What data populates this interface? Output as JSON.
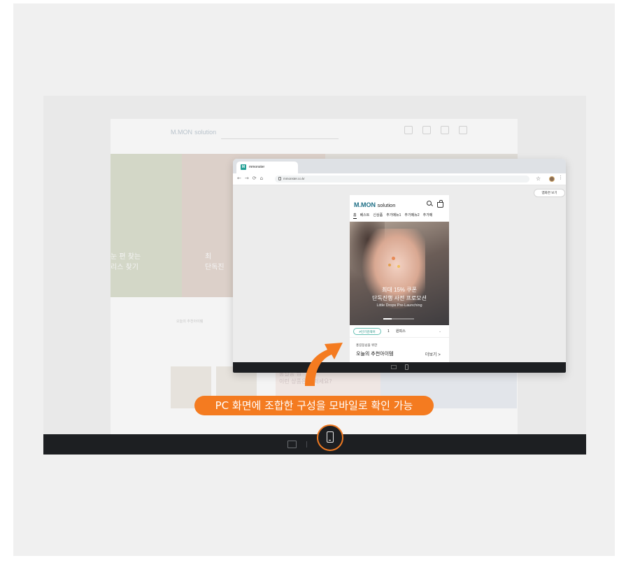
{
  "background_page": {
    "logo_main": "M.MON",
    "logo_sub": "solution",
    "search_placeholder": "",
    "menu": "",
    "hero_left_text": "눈 편 찾는\n리스 찾기",
    "hero_mid_text": "최\n단독진",
    "recommend_sub": "",
    "recommend_title": "오늘의 추천아이템",
    "greeting": "홍길동 님\n이런 상품은 어떠세요?"
  },
  "browser": {
    "tab_title": "mmonster",
    "favicon_letter": "M",
    "url": "mmonster.co.kr",
    "app_button": "앱화면 보기"
  },
  "mobile": {
    "brand_main": "M.MON",
    "brand_sub": "solution",
    "menu": [
      "홈",
      "베스트",
      "신상품",
      "추가메뉴1",
      "추가메뉴2",
      "추가메"
    ],
    "banner": {
      "line1": "최대 15% 쿠폰",
      "line2": "단독진행 사전 프로모션",
      "line3": "Little Drops Pre-Launching"
    },
    "keyword_pill": "#인기검색어",
    "keyword_rank": "1",
    "keyword_word": "원피스",
    "recommend_sub": "홍길동님을 위한",
    "recommend_title": "오늘의 추천아이템",
    "more": "더보기 >"
  },
  "callout": "PC 화면에 조합한 구성을 모바일로 확인 가능",
  "icons": {
    "pc_view": "desktop-icon",
    "mobile_view": "mobile-icon"
  },
  "colors": {
    "accent": "#f47b20",
    "brand_teal": "#1c6d84",
    "keyword": "#1e8f80",
    "bar": "#1d1f22"
  }
}
